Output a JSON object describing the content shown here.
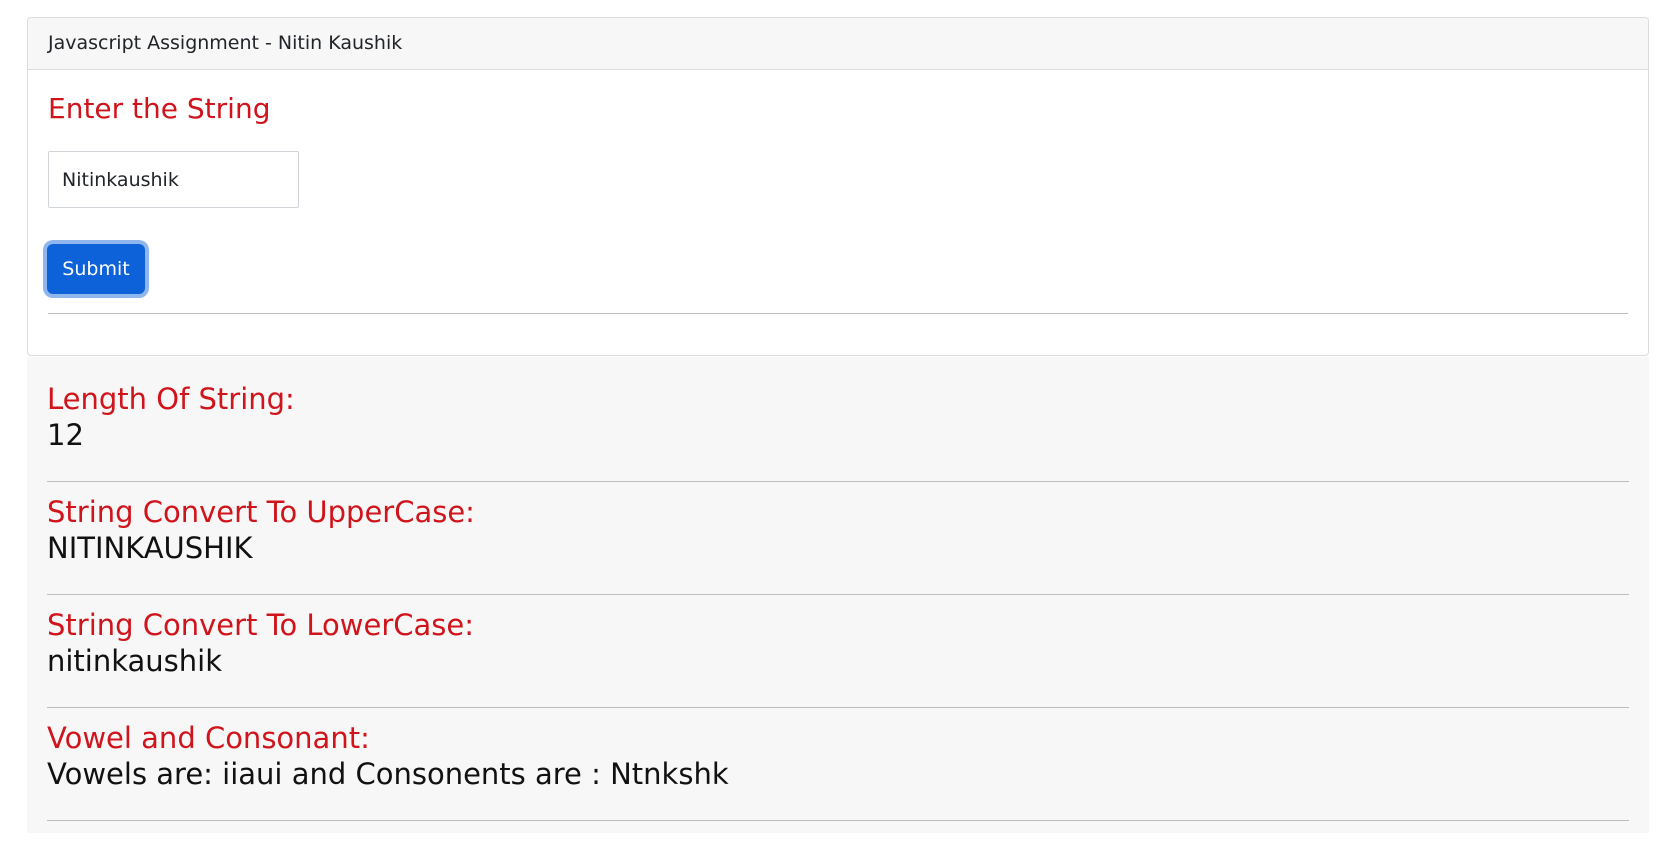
{
  "header": {
    "title": "Javascript Assignment - Nitin Kaushik"
  },
  "form": {
    "heading": "Enter the String",
    "input_value": "Nitinkaushik",
    "submit_label": "Submit"
  },
  "results": [
    {
      "label": "Length Of String:",
      "value": "12"
    },
    {
      "label": "String Convert To UpperCase:",
      "value": "NITINKAUSHIK"
    },
    {
      "label": "String Convert To LowerCase:",
      "value": "nitinkaushik"
    },
    {
      "label": "Vowel and Consonant:",
      "value": "Vowels are: iiaui and Consonents are : Ntnkshk"
    }
  ],
  "colors": {
    "accent_red": "#d0141c",
    "button_blue": "#0d62d9",
    "panel_bg": "#f7f7f7"
  }
}
